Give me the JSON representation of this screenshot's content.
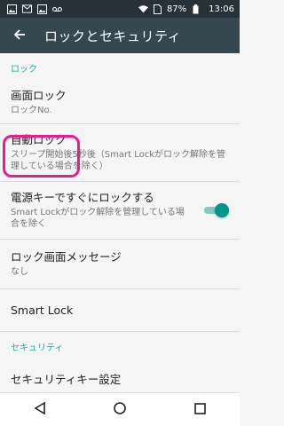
{
  "status_bar": {
    "battery_percent": "87%",
    "time": "13:06",
    "icons_left": [
      "image-icon",
      "mail-icon",
      "image-icon",
      "voicemail-icon"
    ],
    "icons_right": [
      "wifi-icon",
      "sim-icon",
      "battery-icon"
    ]
  },
  "app_bar": {
    "title": "ロックとセキュリティ",
    "back_icon": "arrow-back-icon"
  },
  "sections": {
    "lock": {
      "header": "ロック"
    },
    "security": {
      "header": "セキュリティ"
    }
  },
  "prefs": {
    "screen_lock": {
      "title": "画面ロック",
      "summary": "ロックNo."
    },
    "auto_lock": {
      "title": "自動ロック",
      "summary": "スリープ開始後5秒後（Smart Lockがロック解除を管理している場合を除く）"
    },
    "power_key_lock": {
      "title": "電源キーですぐにロックする",
      "summary": "Smart Lockがロック解除を管理している場合を除く",
      "enabled": true
    },
    "lock_message": {
      "title": "ロック画面メッセージ",
      "summary": "なし"
    },
    "smart_lock": {
      "title": "Smart Lock"
    },
    "security_key": {
      "title": "セキュリティキー設定"
    }
  },
  "colors": {
    "accent": "#009688",
    "highlight": "#e91e8c",
    "app_bar": "#37474f",
    "status_bar": "#263238"
  },
  "nav_bar": {
    "icons": [
      "back-triangle-icon",
      "home-circle-icon",
      "recents-square-icon"
    ]
  }
}
